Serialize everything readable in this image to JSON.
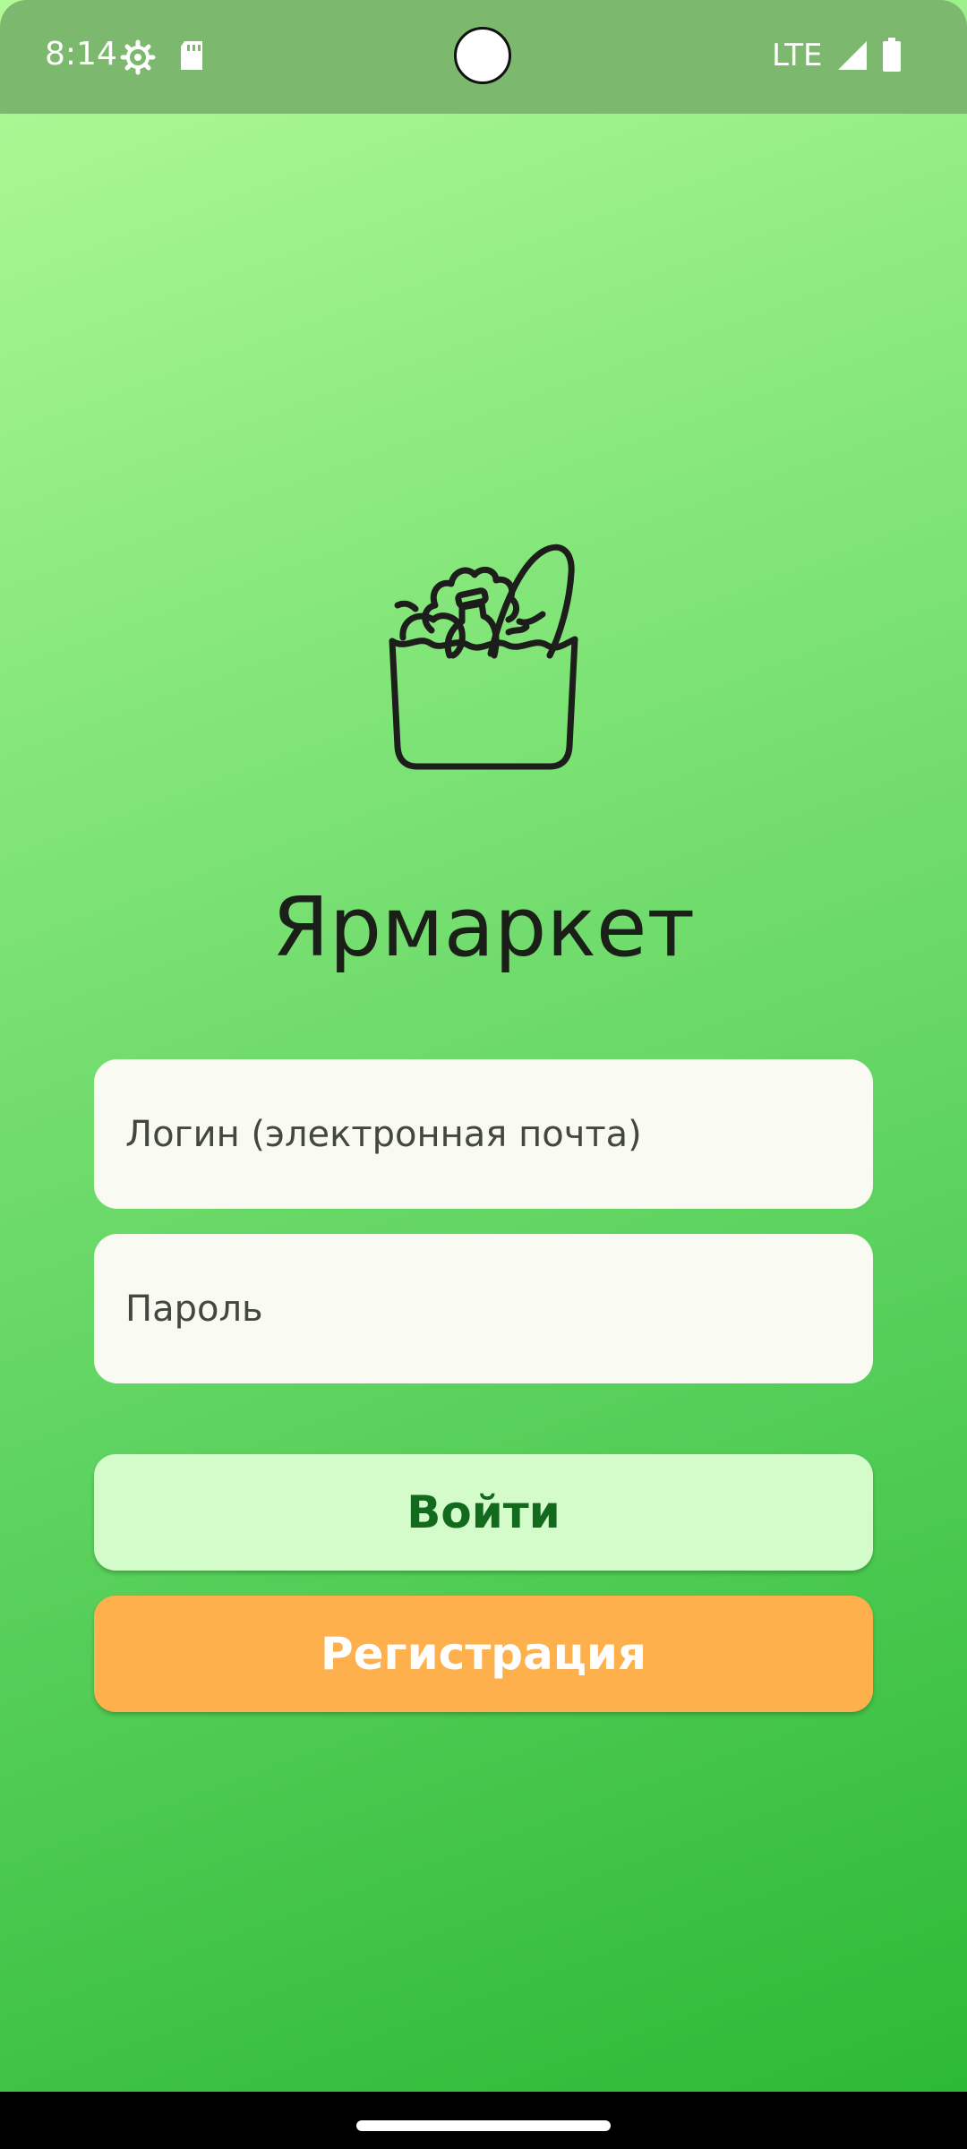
{
  "status_bar": {
    "time": "8:14",
    "network": "LTE",
    "icons": [
      "settings-gear-icon",
      "sd-card-icon",
      "signal-icon",
      "battery-icon"
    ]
  },
  "app": {
    "title": "Ярмаркет",
    "logo_icon": "grocery-bag-icon"
  },
  "form": {
    "login_placeholder": "Логин (электронная почта)",
    "password_placeholder": "Пароль"
  },
  "buttons": {
    "login_label": "Войти",
    "register_label": "Регистрация"
  },
  "colors": {
    "gradient_start": "#b0fa98",
    "gradient_end": "#2cb935",
    "login_button_bg": "#d4fccb",
    "login_button_text": "#126b1c",
    "register_button_bg": "#fdb04c",
    "register_button_text": "#ffffff",
    "field_bg": "#f9fbf3"
  }
}
